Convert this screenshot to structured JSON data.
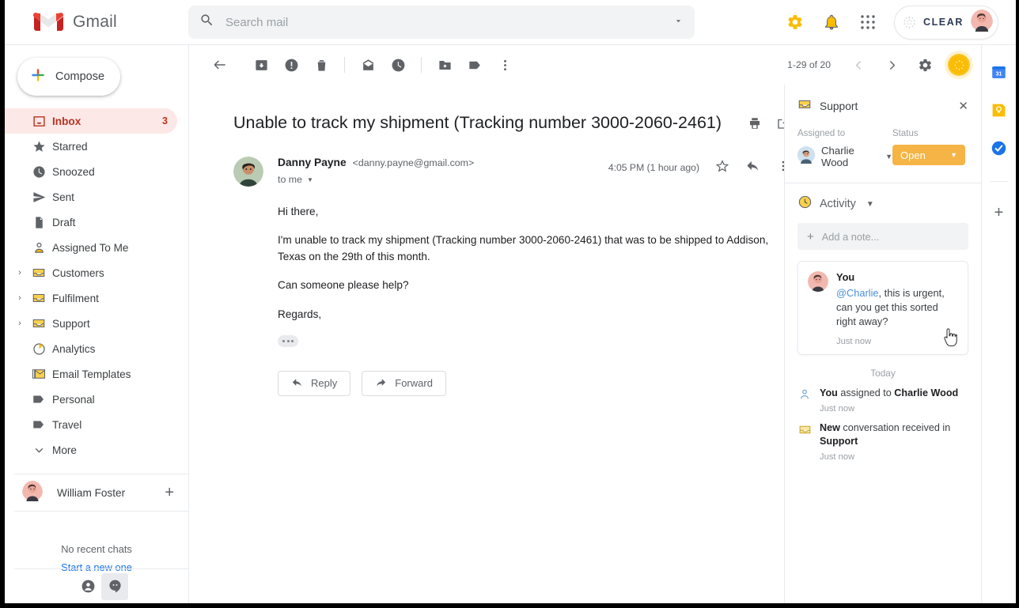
{
  "header": {
    "brand": "Gmail",
    "search_placeholder": "Search mail",
    "search_value": "",
    "clear_badge": "CLEAR"
  },
  "sidebar": {
    "compose": "Compose",
    "items": [
      {
        "label": "Inbox",
        "icon": "inbox-icon",
        "count": "3",
        "active": true,
        "expandable": false
      },
      {
        "label": "Starred",
        "icon": "star-icon",
        "count": "",
        "active": false,
        "expandable": false
      },
      {
        "label": "Snoozed",
        "icon": "clock-icon",
        "count": "",
        "active": false,
        "expandable": false
      },
      {
        "label": "Sent",
        "icon": "send-icon",
        "count": "",
        "active": false,
        "expandable": false
      },
      {
        "label": "Draft",
        "icon": "draft-icon",
        "count": "",
        "active": false,
        "expandable": false
      },
      {
        "label": "Assigned To Me",
        "icon": "person-icon",
        "count": "",
        "active": false,
        "expandable": false
      },
      {
        "label": "Customers",
        "icon": "tray-icon",
        "count": "",
        "active": false,
        "expandable": true
      },
      {
        "label": "Fulfilment",
        "icon": "tray-icon",
        "count": "",
        "active": false,
        "expandable": true
      },
      {
        "label": "Support",
        "icon": "tray-icon",
        "count": "",
        "active": false,
        "expandable": true
      },
      {
        "label": "Analytics",
        "icon": "pie-chart-icon",
        "count": "",
        "active": false,
        "expandable": false
      },
      {
        "label": "Email Templates",
        "icon": "template-icon",
        "count": "",
        "active": false,
        "expandable": false
      },
      {
        "label": "Personal",
        "icon": "label-icon",
        "count": "",
        "active": false,
        "expandable": false
      },
      {
        "label": "Travel",
        "icon": "label-icon",
        "count": "",
        "active": false,
        "expandable": false
      },
      {
        "label": "More",
        "icon": "chevron-down-icon",
        "count": "",
        "active": false,
        "expandable": false
      }
    ],
    "user_name": "William Foster",
    "chats_empty": "No recent chats",
    "chats_start": "Start a new one"
  },
  "toolbar": {
    "count_text": "1-29 of 20",
    "icons": [
      "back-arrow-icon",
      "archive-icon",
      "report-spam-icon",
      "delete-icon",
      "mark-unread-icon",
      "snooze-icon",
      "move-to-icon",
      "labels-icon",
      "more-options-icon"
    ]
  },
  "message": {
    "subject": "Unable to track my shipment (Tracking number 3000-2060-2461)",
    "sender_name": "Danny Payne",
    "sender_email": "<danny.payne@gmail.com>",
    "recipient": "to me",
    "time": "4:05 PM (1 hour ago)",
    "body": [
      "Hi there,",
      "I'm unable to track my shipment (Tracking number 3000-2060-2461) that was to be shipped to Addison, Texas on the 29th of this month.",
      "Can someone please help?",
      "Regards,"
    ],
    "reply_label": "Reply",
    "forward_label": "Forward"
  },
  "right_panel": {
    "title": "Support",
    "assigned_label": "Assigned to",
    "assignee": "Charlie Wood",
    "status_label": "Status",
    "status_value": "Open",
    "status_color": "#f5b445",
    "activity_label": "Activity",
    "add_note_placeholder": "Add a note...",
    "note": {
      "author": "You",
      "mention": "@Charlie",
      "text": ", this is urgent, can you get this sorted right away?",
      "time": "Just now"
    },
    "feed_date": "Today",
    "feed": [
      {
        "icon": "person-icon",
        "bold_start": "You",
        "middle": " assigned to ",
        "bold_end": "Charlie Wood",
        "time": "Just now"
      },
      {
        "icon": "tray-icon",
        "bold_start": "New",
        "middle": " conversation received in ",
        "bold_end": "Support",
        "time": "Just now"
      }
    ]
  },
  "rail": {
    "items": [
      "calendar-icon",
      "keep-icon",
      "tasks-icon"
    ],
    "add": "+"
  }
}
